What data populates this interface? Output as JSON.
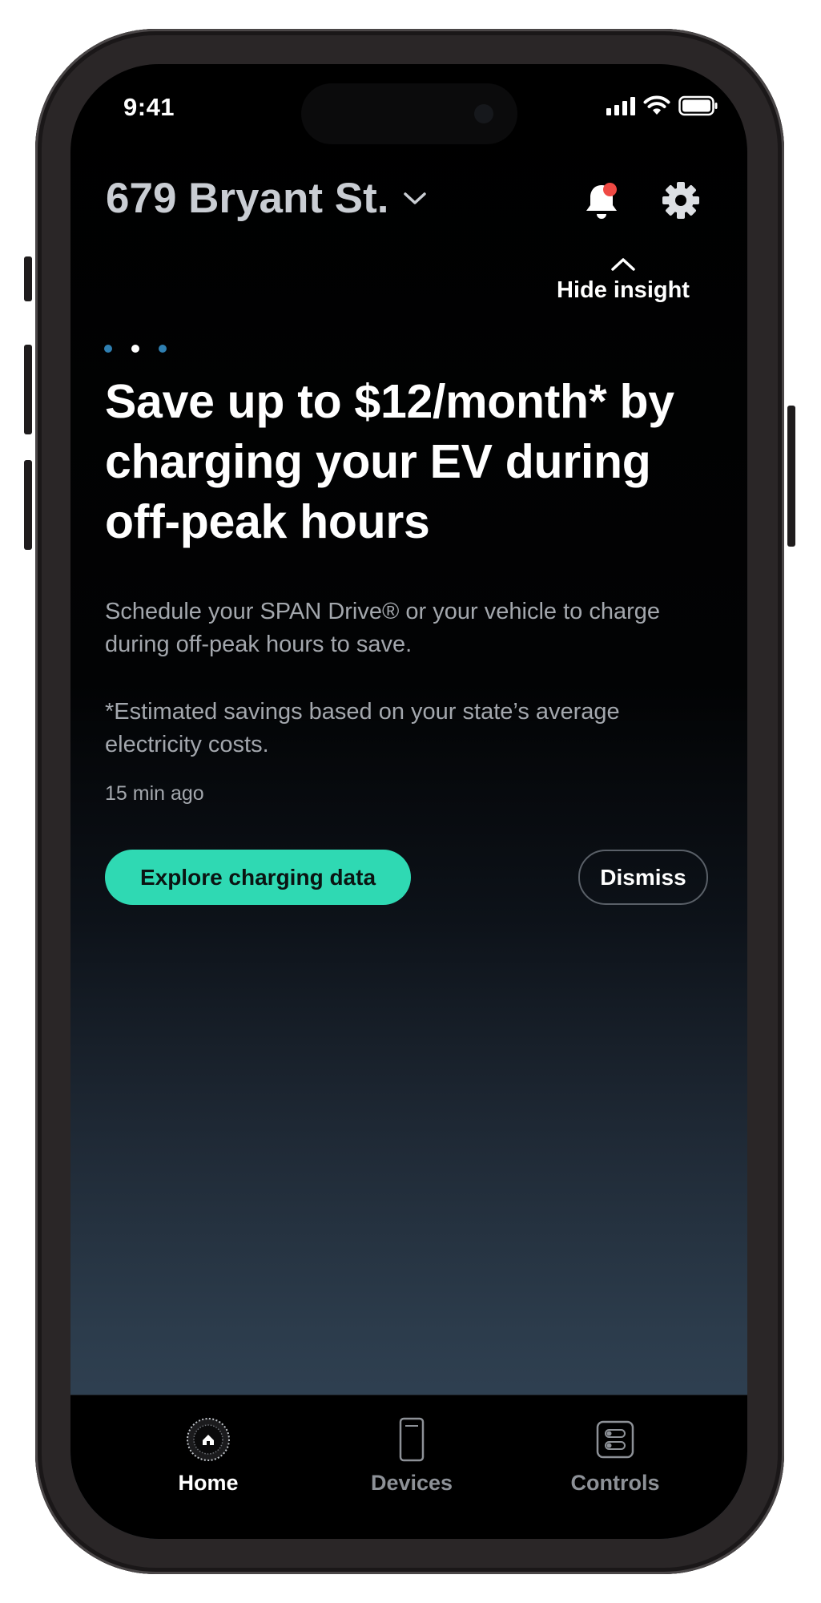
{
  "status_bar": {
    "time": "9:41"
  },
  "header": {
    "address": "679 Bryant St.",
    "hide_insight_label": "Hide insight"
  },
  "insight": {
    "headline": "Save up to $12/month* by charging your EV during off-peak hours",
    "body": "Schedule your SPAN Drive® or your vehicle to charge during off-peak hours to save.",
    "footnote": "*Estimated savings based on your state’s average electricity costs.",
    "timestamp": "15 min ago",
    "primary_action": "Explore charging data",
    "secondary_action": "Dismiss",
    "carousel": {
      "total": 3,
      "active_index": 1
    }
  },
  "tabs": [
    {
      "label": "Home",
      "icon": "home-icon",
      "active": true
    },
    {
      "label": "Devices",
      "icon": "panel-device-icon",
      "active": false
    },
    {
      "label": "Controls",
      "icon": "toggle-controls-icon",
      "active": false
    }
  ],
  "colors": {
    "accent": "#2fd9b3",
    "notification_dot": "#ef4a44",
    "carousel_dot": "#2f7fb1"
  }
}
